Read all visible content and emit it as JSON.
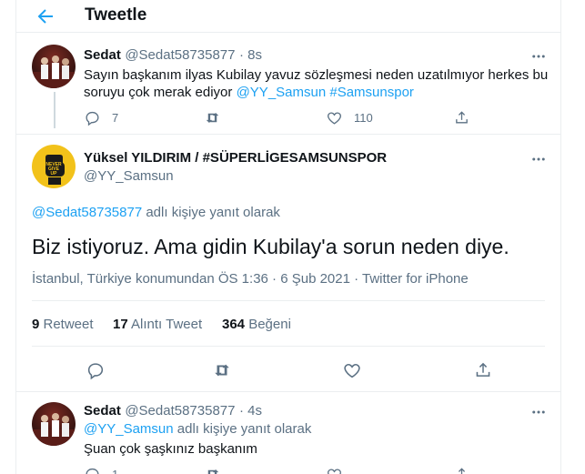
{
  "header": {
    "title": "Tweetle"
  },
  "tweets": [
    {
      "name": "Sedat",
      "handle": "@Sedat58735877",
      "time": "· 8s",
      "text": "Sayın başkanım ilyas Kubilay yavuz sözleşmesi neden uzatılmıyor herkes bu",
      "text2": "soruyu çok merak ediyor ",
      "mention": "@YY_Samsun",
      "hashtag": " #Samsunspor",
      "replies": "7",
      "retweets": "",
      "likes": "110"
    },
    {
      "name": "Sedat",
      "handle": "@Sedat58735877",
      "time": "· 4s",
      "reply_to_handle": "@YY_Samsun",
      "reply_to_suffix": " adlı kişiye yanıt olarak",
      "text": "Şuan çok şaşkınız başkanım",
      "replies": "1"
    }
  ],
  "main_tweet": {
    "name": "Yüksel YILDIRIM / #SÜPERLİGESAMSUNSPOR",
    "handle": "@YY_Samsun",
    "reply_to_handle": "@Sedat58735877",
    "reply_to_suffix": " adlı kişiye yanıt olarak",
    "text": "Biz istiyoruz. Ama gidin Kubilay'a sorun neden diye.",
    "meta": "İstanbul, Türkiye konumundan ÖS 1:36 · 6 Şub 2021 · Twitter for iPhone",
    "retweet_count": "9",
    "retweet_label": " Retweet",
    "quote_count": "17",
    "quote_label": " Alıntı Tweet",
    "like_count": "364",
    "like_label": " Beğeni",
    "logo_text": [
      "NEVER",
      "GIVE",
      "UP"
    ]
  },
  "colors": {
    "accent": "#1da1f2",
    "muted": "#5b7083",
    "border": "#ebeef0",
    "logo": "#f2c21a"
  }
}
